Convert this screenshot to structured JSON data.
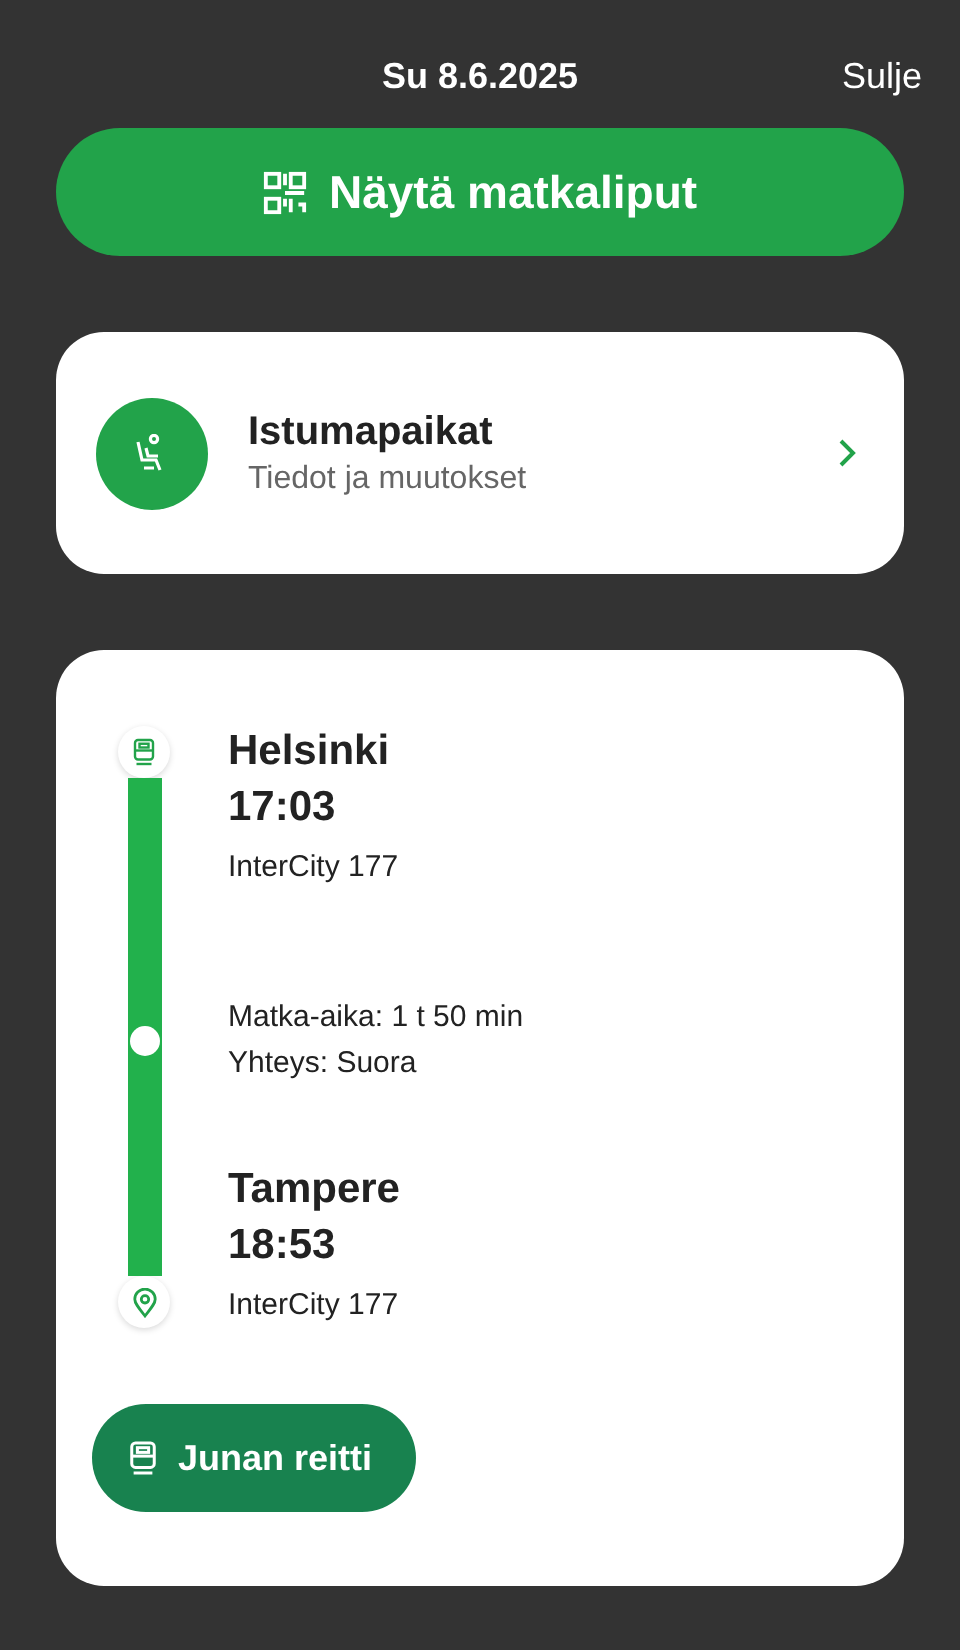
{
  "header": {
    "date": "Su 8.6.2025",
    "close": "Sulje"
  },
  "tickets_button": {
    "label": "Näytä matkaliput"
  },
  "seats": {
    "title": "Istumapaikat",
    "subtitle": "Tiedot ja muutokset"
  },
  "journey": {
    "stops": [
      {
        "kind": "departure",
        "station": "Helsinki",
        "time": "17:03",
        "train": "InterCity 177"
      },
      {
        "kind": "arrival",
        "station": "Tampere",
        "time": "18:53",
        "train": "InterCity 177"
      }
    ],
    "duration": "Matka-aika: 1 t 50 min",
    "connection": "Yhteys: Suora",
    "route_button": "Junan reitti"
  }
}
